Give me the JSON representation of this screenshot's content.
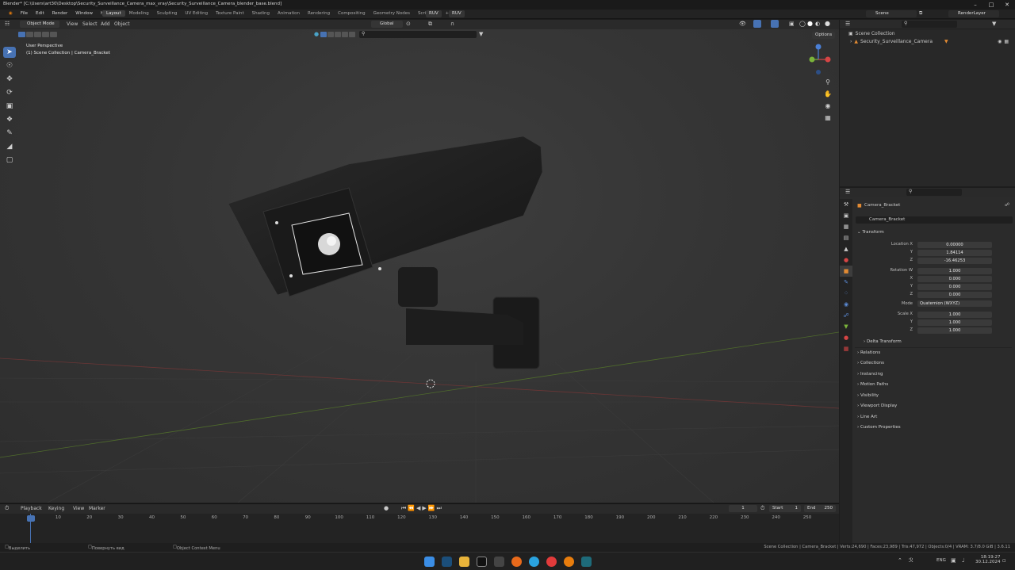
{
  "window": {
    "title": "Blender* [C:\\Users\\art30\\Desktop\\Security_Surveillance_Camera_max_vray\\Security_Surveillance_Camera_blender_base.blend]"
  },
  "menu": [
    "File",
    "Edit",
    "Render",
    "Window",
    "Help"
  ],
  "workspaces": [
    "Layout",
    "Modeling",
    "Sculpting",
    "UV Editing",
    "Texture Paint",
    "Shading",
    "Animation",
    "Rendering",
    "Compositing",
    "Geometry Nodes",
    "Scripting"
  ],
  "ruv": [
    "RUV",
    "RUV"
  ],
  "scene": "Scene",
  "render_layer": "RenderLayer",
  "viewport_header": {
    "mode": "Object Mode",
    "menus": [
      "View",
      "Select",
      "Add",
      "Object"
    ],
    "orientation": "Global",
    "options": "Options"
  },
  "viewport_info": {
    "line1": "User Perspective",
    "line2": "(1) Scene Collection | Camera_Bracket"
  },
  "outliner": {
    "root": "Scene Collection",
    "item": "Security_Surveillance_Camera"
  },
  "properties": {
    "object_name": "Camera_Bracket",
    "datablock": "Camera_Bracket",
    "transform": "Transform",
    "location_label": "Location X",
    "location": [
      "0.00000",
      "1.84114",
      "-16.46253"
    ],
    "rotation_label": "Rotation W",
    "rotation": [
      "1.000",
      "0.000",
      "0.000",
      "0.000"
    ],
    "mode_label": "Mode",
    "mode": "Quaternion (WXYZ)",
    "scale_label": "Scale X",
    "scale": [
      "1.000",
      "1.000",
      "1.000"
    ],
    "axis": {
      "x": "X",
      "y": "Y",
      "z": "Z"
    },
    "delta": "Delta Transform",
    "sections": [
      "Relations",
      "Collections",
      "Instancing",
      "Motion Paths",
      "Visibility",
      "Viewport Display",
      "Line Art",
      "Custom Properties"
    ]
  },
  "timeline": {
    "menus": [
      "Playback",
      "Keying",
      "View",
      "Marker"
    ],
    "current": "1",
    "start_label": "Start",
    "start": "1",
    "end_label": "End",
    "end": "250",
    "ticks": [
      "1",
      "10",
      "20",
      "30",
      "40",
      "50",
      "60",
      "70",
      "80",
      "90",
      "100",
      "110",
      "120",
      "130",
      "140",
      "150",
      "160",
      "170",
      "180",
      "190",
      "200",
      "210",
      "220",
      "230",
      "240",
      "250"
    ]
  },
  "status": {
    "left": "Выделить",
    "mid": "Повернуть вид",
    "ctx": "Object Context Menu",
    "right": "Scene Collection | Camera_Bracket | Verts:24,690 | Faces:23,989 | Tris:47,972 | Objects:0/4 | VRAM: 3.7/8.0 GiB | 3.6.11"
  },
  "taskbar": {
    "lang": "ENG",
    "time": "18:19:27",
    "date": "30.12.2024"
  },
  "colors": {
    "accent": "#4772b3",
    "bg": "#1d1d1d"
  }
}
